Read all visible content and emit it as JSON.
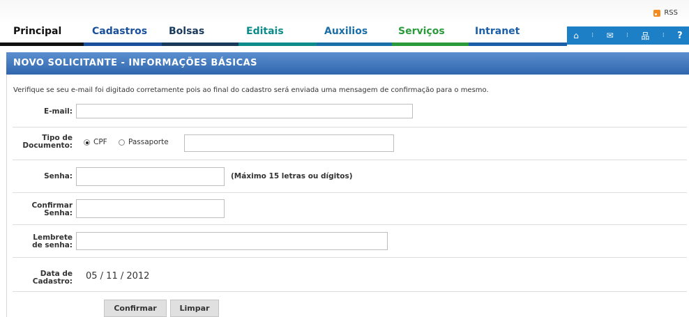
{
  "rss": {
    "label": "RSS"
  },
  "nav": [
    {
      "label": "Principal",
      "color": "#111111",
      "bar": "#111111"
    },
    {
      "label": "Cadastros",
      "color": "#1a4f9c",
      "bar": "#1a4f9c"
    },
    {
      "label": "Bolsas",
      "color": "#1a3a5c",
      "bar": "#1a3a5c"
    },
    {
      "label": "Editais",
      "color": "#0d8a8a",
      "bar": "#0d8a8a"
    },
    {
      "label": "Auxilios",
      "color": "#1a6fa8",
      "bar": "#1a6fa8"
    },
    {
      "label": "Serviços",
      "color": "#2b9a3b",
      "bar": "#2b9a3b"
    },
    {
      "label": "Intranet",
      "color": "#1a5fa8",
      "bar": "#1a5fa8"
    }
  ],
  "toolbar_icons": [
    "home-icon",
    "mail-icon",
    "sitemap-icon",
    "help-icon"
  ],
  "toolbar_help": "?",
  "header": {
    "title": "NOVO SOLICITANTE - INFORMAÇÕES BÁSICAS"
  },
  "intro": "Verifique se seu e-mail foi digitado corretamente pois ao final do cadastro será enviada uma mensagem de confirmação para o mesmo.",
  "form": {
    "email_label": "E-mail:",
    "tipo_label_1": "Tipo de",
    "tipo_label_2": "Documento:",
    "cpf_label": "CPF",
    "passaporte_label": "Passaporte",
    "senha_label": "Senha:",
    "senha_hint": "(Máximo 15 letras ou dígitos)",
    "confirmar_label_1": "Confirmar",
    "confirmar_label_2": "Senha:",
    "lembrete_label_1": "Lembrete",
    "lembrete_label_2": "de senha:",
    "data_label_1": "Data de",
    "data_label_2": "Cadastro:",
    "data_value": "05 / 11 / 2012"
  },
  "buttons": {
    "confirm": "Confirmar",
    "clear": "Limpar"
  }
}
